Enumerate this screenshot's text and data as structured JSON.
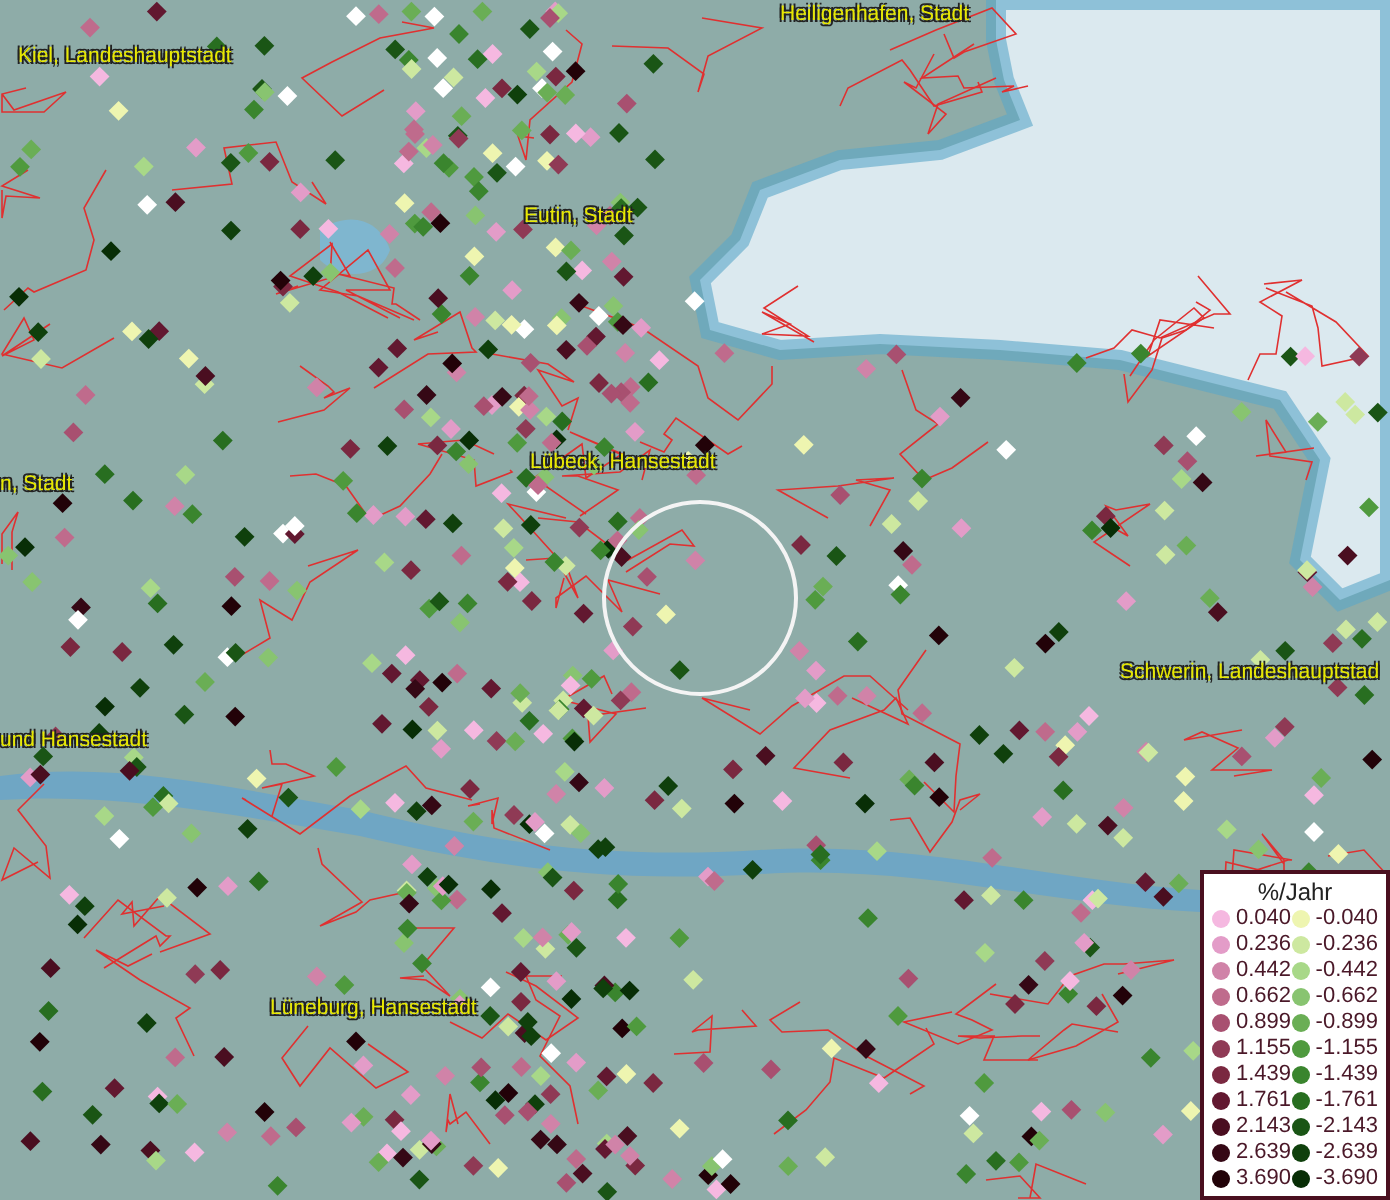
{
  "map": {
    "labels": [
      "Heiligenhafen, Stadt",
      "Kiel, Landeshauptstadt",
      "Eutin, Stadt",
      "n, Stadt",
      "Lübeck, Hansestadt",
      "und Hansestadt",
      "Schwerin, Landeshauptstad",
      "Lüneburg, Hansestadt"
    ]
  },
  "legend": {
    "title": "%/Jahr",
    "positive": [
      {
        "label": "0.040",
        "color": "#f5b8e0"
      },
      {
        "label": "0.236",
        "color": "#e39cc8"
      },
      {
        "label": "0.442",
        "color": "#d083a8"
      },
      {
        "label": "0.662",
        "color": "#bf6b8c"
      },
      {
        "label": "0.899",
        "color": "#a85070"
      },
      {
        "label": "1.155",
        "color": "#8f3a55"
      },
      {
        "label": "1.439",
        "color": "#7a2840"
      },
      {
        "label": "1.761",
        "color": "#621830"
      },
      {
        "label": "2.143",
        "color": "#4a0e20"
      },
      {
        "label": "2.639",
        "color": "#350815"
      },
      {
        "label": "3.690",
        "color": "#220208"
      }
    ],
    "negative": [
      {
        "label": "-0.040",
        "color": "#eef5b0"
      },
      {
        "label": "-0.236",
        "color": "#cde8a0"
      },
      {
        "label": "-0.442",
        "color": "#a8d888"
      },
      {
        "label": "-0.662",
        "color": "#88c470"
      },
      {
        "label": "-0.899",
        "color": "#6aae55"
      },
      {
        "label": "-1.155",
        "color": "#4f9a3e"
      },
      {
        "label": "-1.439",
        "color": "#3a852e"
      },
      {
        "label": "-1.761",
        "color": "#286e20"
      },
      {
        "label": "-2.143",
        "color": "#1a5515"
      },
      {
        "label": "-2.639",
        "color": "#0f400c"
      },
      {
        "label": "-3.690",
        "color": "#082e06"
      }
    ]
  }
}
